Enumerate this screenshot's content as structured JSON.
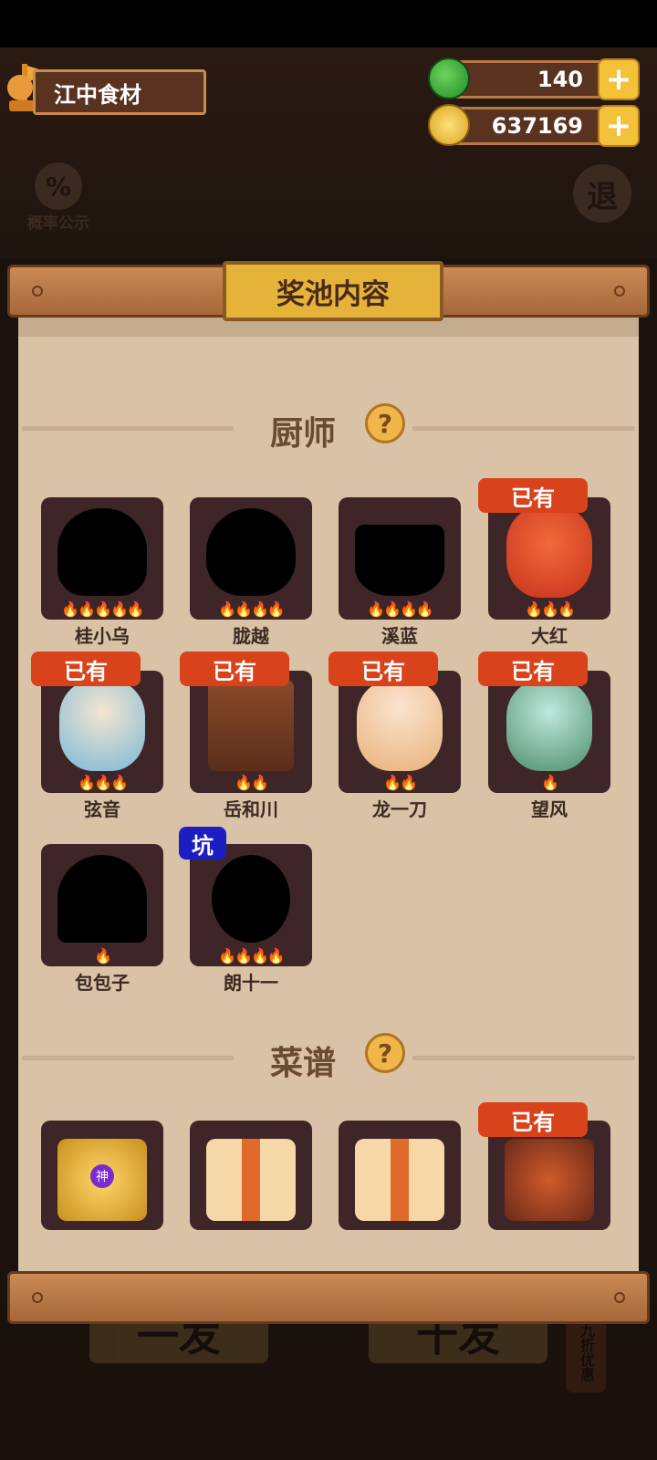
{
  "header": {
    "location": "江中食材",
    "jade_amount": "140",
    "coin_amount": "637169",
    "probability_label": "概率公示",
    "exit_label": "退"
  },
  "panel": {
    "title": "奖池内容"
  },
  "sections": {
    "chefs_title": "厨师",
    "recipes_title": "菜谱",
    "help_glyph": "?"
  },
  "chefs": [
    {
      "name": "桂小乌",
      "owned": false,
      "flames": "🔥🔥🔥🔥🔥"
    },
    {
      "name": "胧越",
      "owned": false,
      "flames": "🔥🔥🔥🔥"
    },
    {
      "name": "溪蓝",
      "owned": false,
      "flames": "🔥🔥🔥🔥"
    },
    {
      "name": "大红",
      "owned": true,
      "flames": "🔥🔥🔥"
    },
    {
      "name": "弦音",
      "owned": true,
      "flames": "🔥🔥🔥"
    },
    {
      "name": "岳和川",
      "owned": true,
      "flames": "🔥🔥"
    },
    {
      "name": "龙一刀",
      "owned": true,
      "flames": "🔥🔥"
    },
    {
      "name": "望风",
      "owned": true,
      "flames": "🔥"
    },
    {
      "name": "包包子",
      "owned": false,
      "flames": "🔥"
    },
    {
      "name": "朗十一",
      "owned": false,
      "flames": "🔥🔥🔥🔥",
      "tag": "坑"
    }
  ],
  "tags": {
    "owned": "已有",
    "pit": "坑",
    "god": "神"
  },
  "recipes": [
    {
      "kind": "gold-treasure",
      "owned": false
    },
    {
      "kind": "scroll",
      "owned": false
    },
    {
      "kind": "scroll",
      "owned": false
    },
    {
      "kind": "dish",
      "owned": true
    }
  ],
  "bottom": {
    "single_draw": "一发",
    "ten_draw": "十发",
    "discount": "九折优惠"
  },
  "colors": {
    "owned_tag": "#d8431c",
    "pit_tag": "#1c1ec4",
    "card_bg": "#3d2528",
    "paper": "#d9c2a6"
  }
}
